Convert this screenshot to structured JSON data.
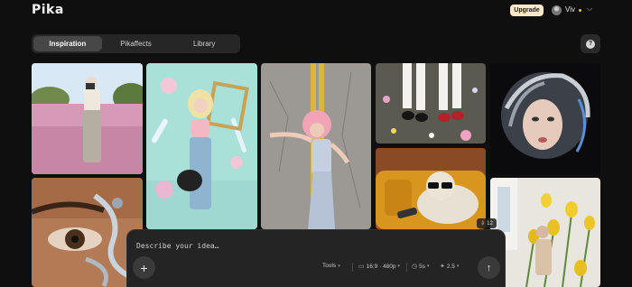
{
  "header": {
    "logo": "Pika",
    "upgrade_label": "Upgrade",
    "username": "Viv"
  },
  "tabs": [
    {
      "label": "Inspiration",
      "active": true
    },
    {
      "label": "Pikaffects",
      "active": false
    },
    {
      "label": "Library",
      "active": false
    }
  ],
  "help_label": "?",
  "gallery": {
    "badge_count": "12",
    "badge_icon": "download-icon"
  },
  "prompt": {
    "placeholder": "Describe your idea…",
    "add_label": "+",
    "tools_label": "Tools",
    "aspect_label": "16:9 · 480p",
    "duration_label": "5s",
    "model_label": "2.5",
    "send_label": "↑"
  },
  "colors": {
    "background": "#0f0f0f",
    "upgrade_bg": "#fbe8c8",
    "status_dot": "#f0c35b",
    "panel": "#242424"
  }
}
